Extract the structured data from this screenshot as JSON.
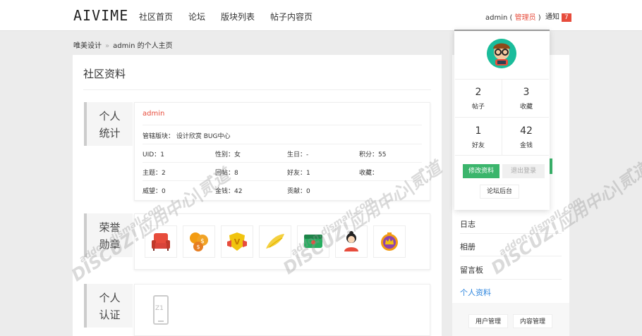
{
  "header": {
    "logo": "AIVIME",
    "nav": [
      "社区首页",
      "论坛",
      "版块列表",
      "帖子内容页"
    ],
    "username": "admin",
    "role_open": " ( ",
    "role": "管理员",
    "role_close": " )",
    "notice": "通知",
    "notice_count": "7"
  },
  "breadcrumb": {
    "home": "唯美设计",
    "sep": "»",
    "current": "admin 的个人主页"
  },
  "main": {
    "title": "社区资料",
    "stats": {
      "label": "个人\n统计",
      "name": "admin",
      "manage": "管辖版块：  设计欣赏  BUG中心",
      "fields": [
        [
          "UID：",
          "1"
        ],
        [
          "性别：",
          "女"
        ],
        [
          "生日：",
          "-"
        ],
        [
          "积分：",
          "55"
        ],
        [
          "主题：",
          "2"
        ],
        [
          "回帖：",
          "8"
        ],
        [
          "好友：",
          "1"
        ],
        [
          "收藏：",
          ""
        ],
        [
          "威望：",
          "0"
        ],
        [
          "金钱：",
          "42"
        ],
        [
          "贡献：",
          "0"
        ]
      ]
    },
    "honor": {
      "label": "荣誉\n勋章",
      "medals": [
        "sofa-medal-icon",
        "coins-medal-icon",
        "v-shield-medal-icon",
        "wing-medal-icon",
        "green-box-medal-icon",
        "girl-avatar-medal-icon",
        "crown-medal-icon"
      ]
    },
    "verify": {
      "label": "个人\n认证",
      "phone_text": "Z1"
    }
  },
  "popup": {
    "stats": [
      {
        "num": "2",
        "label": "帖子"
      },
      {
        "num": "3",
        "label": "收藏"
      },
      {
        "num": "1",
        "label": "好友"
      },
      {
        "num": "42",
        "label": "金钱"
      }
    ],
    "edit": "修改资料",
    "logout": "退出登录",
    "admin": "论坛后台"
  },
  "side": {
    "items": [
      "日志",
      "相册",
      "留言板",
      "个人资料"
    ],
    "active": "个人资料",
    "buttons": [
      "用户管理",
      "内容管理"
    ]
  },
  "watermark": {
    "brand": "DISCUZ!应用中心",
    "sub": "addon.dismall.com",
    "mark": "贰道"
  },
  "colors": {
    "accent": "#e74c3c",
    "green": "#3bb56c"
  }
}
